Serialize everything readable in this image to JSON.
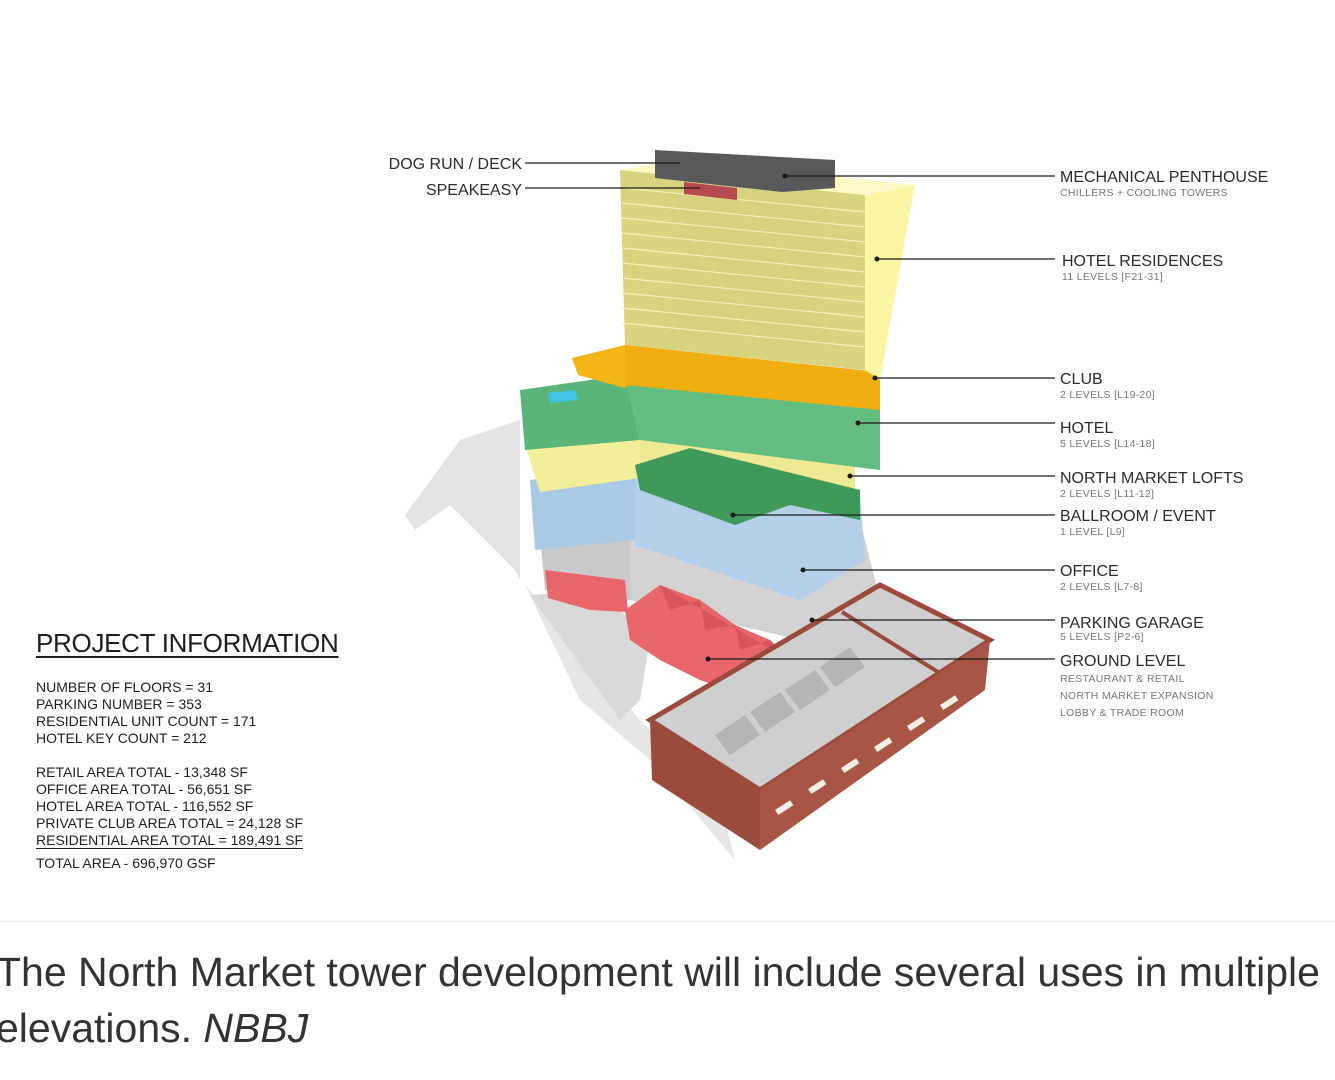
{
  "diagram": {
    "left_labels": [
      {
        "id": "dog-run",
        "title": "DOG RUN / DECK"
      },
      {
        "id": "speakeasy",
        "title": "SPEAKEASY"
      }
    ],
    "right_labels": [
      {
        "id": "mechanical-penthouse",
        "title": "MECHANICAL PENTHOUSE",
        "sub": [
          "CHILLERS + COOLING TOWERS"
        ]
      },
      {
        "id": "hotel-residences",
        "title": "HOTEL RESIDENCES",
        "sub": [
          "11 LEVELS [F21-31]"
        ]
      },
      {
        "id": "club",
        "title": "CLUB",
        "sub": [
          "2 LEVELS [L19-20]"
        ]
      },
      {
        "id": "hotel",
        "title": "HOTEL",
        "sub": [
          "5 LEVELS [L14-18]"
        ]
      },
      {
        "id": "north-market-lofts",
        "title": "NORTH MARKET LOFTS",
        "sub": [
          "2 LEVELS [L11-12]"
        ]
      },
      {
        "id": "ballroom-event",
        "title": "BALLROOM / EVENT",
        "sub": [
          "1 LEVEL [L9]"
        ]
      },
      {
        "id": "office",
        "title": "OFFICE",
        "sub": [
          "2 LEVELS [L7-8]"
        ]
      },
      {
        "id": "parking-garage",
        "title": "PARKING GARAGE",
        "sub": [
          "5 LEVELS [P2-6]"
        ]
      },
      {
        "id": "ground-level",
        "title": "GROUND LEVEL",
        "sub": [
          "RESTAURANT & RETAIL",
          "NORTH MARKET EXPANSION",
          "LOBBY & TRADE ROOM"
        ]
      }
    ],
    "colors": {
      "penthouse": "#58595b",
      "residences": "#fbf6a4",
      "residences_face": "#d4cf7a",
      "club": "#f4b516",
      "hotel": "#5bb57a",
      "lofts": "#f3ee9a",
      "ballroom": "#3f9a5a",
      "office": "#a9c9e4",
      "parking": "#c4c4c4",
      "ground_retail": "#e9666b",
      "brick": "#9b4b3c",
      "roof": "#cfcfcf",
      "shadow": "#e2e2e2"
    }
  },
  "project_info": {
    "title": "PROJECT INFORMATION",
    "counts": [
      "NUMBER OF FLOORS = 31",
      "PARKING NUMBER = 353",
      "RESIDENTIAL UNIT COUNT = 171",
      "HOTEL KEY COUNT =  212"
    ],
    "areas": [
      "RETAIL AREA TOTAL - 13,348 SF",
      "OFFICE AREA TOTAL - 56,651 SF",
      "HOTEL AREA TOTAL - 116,552 SF",
      "PRIVATE CLUB AREA TOTAL = 24,128 SF"
    ],
    "residential": "RESIDENTIAL AREA TOTAL = 189,491 SF",
    "total": "TOTAL AREA - 696,970 GSF"
  },
  "caption": {
    "text": "The North Market tower development will include several uses in multiple elevations. ",
    "credit": "NBBJ"
  }
}
